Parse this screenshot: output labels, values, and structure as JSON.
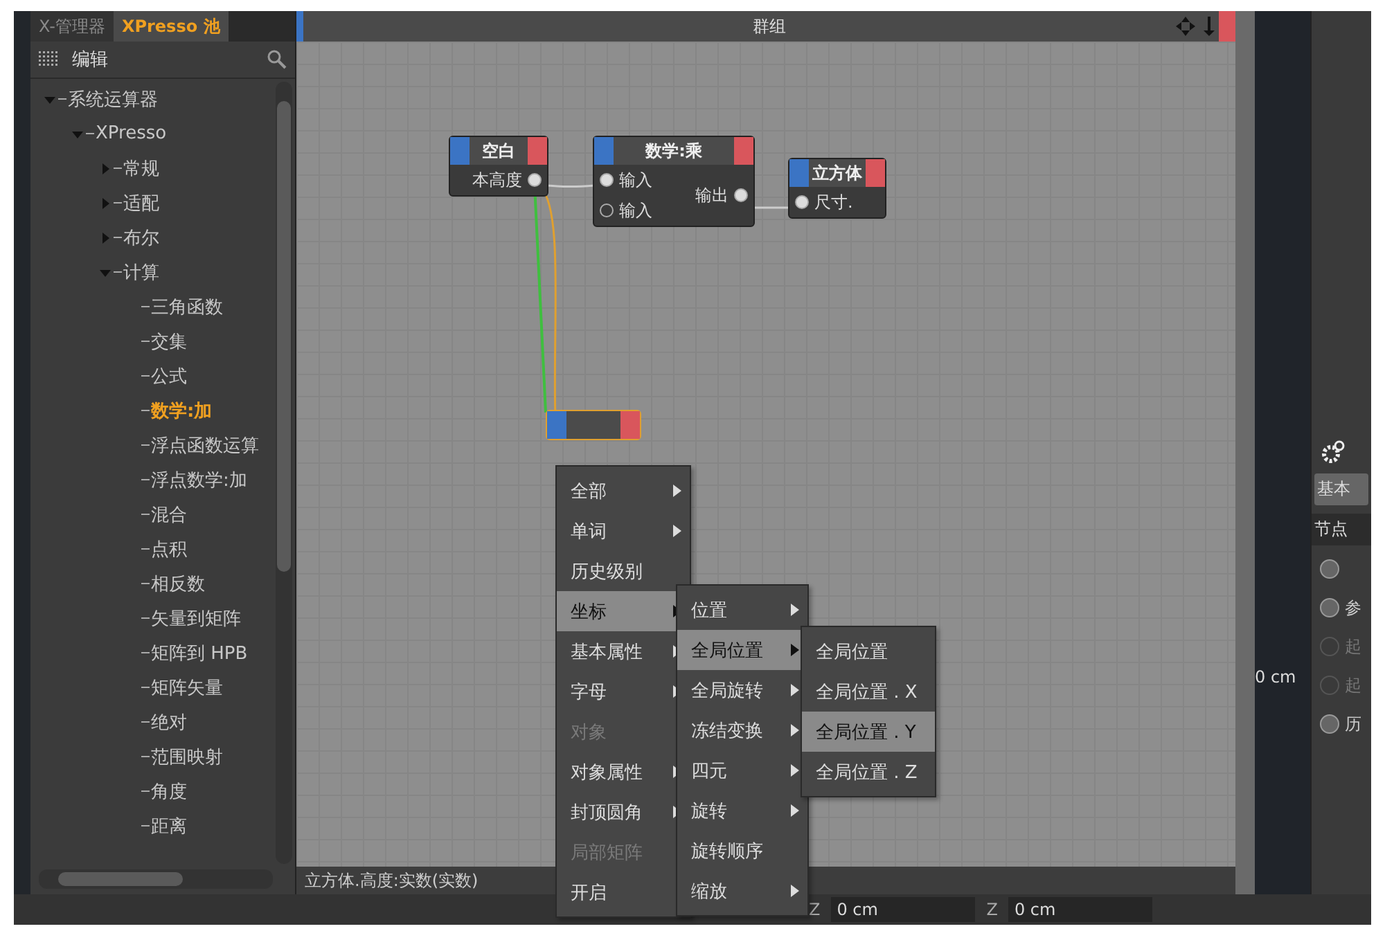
{
  "left_panel": {
    "tabs": [
      {
        "label": "X-管理器",
        "selected": false
      },
      {
        "label": "XPresso 池",
        "selected": true
      }
    ],
    "header": {
      "title": "编辑"
    },
    "tree": [
      {
        "label": "系统运算器",
        "expanded": true,
        "children": [
          {
            "label": "XPresso",
            "expanded": true,
            "children": [
              {
                "label": "常规",
                "expanded": false
              },
              {
                "label": "适配",
                "expanded": false
              },
              {
                "label": "布尔",
                "expanded": false
              },
              {
                "label": "计算",
                "expanded": true,
                "children": [
                  {
                    "label": "三角函数",
                    "selected": false
                  },
                  {
                    "label": "交集",
                    "selected": false
                  },
                  {
                    "label": "公式",
                    "selected": false
                  },
                  {
                    "label": "数学:加",
                    "selected": true
                  },
                  {
                    "label": "浮点函数运算",
                    "selected": false
                  },
                  {
                    "label": "浮点数学:加",
                    "selected": false
                  },
                  {
                    "label": "混合",
                    "selected": false
                  },
                  {
                    "label": "点积",
                    "selected": false
                  },
                  {
                    "label": "相反数",
                    "selected": false
                  },
                  {
                    "label": "矢量到矩阵",
                    "selected": false
                  },
                  {
                    "label": "矩阵到 HPB",
                    "selected": false
                  },
                  {
                    "label": "矩阵矢量",
                    "selected": false
                  },
                  {
                    "label": "绝对",
                    "selected": false
                  },
                  {
                    "label": "范围映射",
                    "selected": false
                  },
                  {
                    "label": "角度",
                    "selected": false
                  },
                  {
                    "label": "距离",
                    "selected": false
                  }
                ]
              }
            ]
          }
        ]
      }
    ]
  },
  "editor": {
    "title": "群组",
    "nodes": [
      {
        "title": "空白",
        "ports": [
          {
            "label": "本高度",
            "kind": "output",
            "connected": true
          }
        ]
      },
      {
        "title": "数学:乘",
        "ports": [
          {
            "label": "输入",
            "kind": "input",
            "connected": true
          },
          {
            "label": "输入",
            "kind": "input",
            "connected": false
          },
          {
            "label": "输出",
            "kind": "output",
            "connected": true
          }
        ]
      },
      {
        "title": "立方体",
        "ports": [
          {
            "label": "尺寸.",
            "kind": "input",
            "connected": true
          }
        ]
      },
      {
        "selected": true
      }
    ],
    "menus": [
      {
        "items": [
          {
            "label": "全部",
            "submenu": true,
            "disabled": false,
            "selected": false
          },
          {
            "label": "单词",
            "submenu": true,
            "disabled": false,
            "selected": false
          },
          {
            "label": "历史级别",
            "submenu": false,
            "disabled": false,
            "selected": false
          },
          {
            "label": "坐标",
            "submenu": true,
            "disabled": false,
            "selected": true
          },
          {
            "label": "基本属性",
            "submenu": true,
            "disabled": false,
            "selected": false
          },
          {
            "label": "字母",
            "submenu": true,
            "disabled": false,
            "selected": false
          },
          {
            "label": "对象",
            "submenu": false,
            "disabled": true,
            "selected": false
          },
          {
            "label": "对象属性",
            "submenu": true,
            "disabled": false,
            "selected": false
          },
          {
            "label": "封顶圆角",
            "submenu": true,
            "disabled": false,
            "selected": false
          },
          {
            "label": "局部矩阵",
            "submenu": false,
            "disabled": true,
            "selected": false
          },
          {
            "label": "开启",
            "submenu": false,
            "disabled": false,
            "selected": false
          }
        ]
      },
      {
        "items": [
          {
            "label": "位置",
            "submenu": true,
            "disabled": false,
            "selected": false
          },
          {
            "label": "全局位置",
            "submenu": true,
            "disabled": false,
            "selected": true
          },
          {
            "label": "全局旋转",
            "submenu": true,
            "disabled": false,
            "selected": false
          },
          {
            "label": "冻结变换",
            "submenu": true,
            "disabled": false,
            "selected": false
          },
          {
            "label": "四元",
            "submenu": true,
            "disabled": false,
            "selected": false
          },
          {
            "label": "旋转",
            "submenu": true,
            "disabled": false,
            "selected": false
          },
          {
            "label": "旋转顺序",
            "submenu": false,
            "disabled": false,
            "selected": false
          },
          {
            "label": "缩放",
            "submenu": true,
            "disabled": false,
            "selected": false
          }
        ]
      },
      {
        "items": [
          {
            "label": "全局位置",
            "submenu": false,
            "disabled": false,
            "selected": false
          },
          {
            "label": "全局位置 . X",
            "submenu": false,
            "disabled": false,
            "selected": false
          },
          {
            "label": "全局位置 . Y",
            "submenu": false,
            "disabled": false,
            "selected": true
          },
          {
            "label": "全局位置 . Z",
            "submenu": false,
            "disabled": false,
            "selected": false
          }
        ]
      }
    ],
    "status": "立方体.高度:实数(实数)"
  },
  "viewport": {
    "reading": "0 cm"
  },
  "right_panel": {
    "tab": "基本",
    "section": "节点",
    "options": [
      {
        "enabled": true
      },
      {
        "label": "参",
        "enabled": true
      },
      {
        "label": "起",
        "enabled": false
      },
      {
        "label": "起",
        "enabled": false
      },
      {
        "label": "历",
        "enabled": true
      }
    ]
  },
  "coordinates": [
    {
      "axis": "Z",
      "value": "0 cm"
    },
    {
      "axis": "Z",
      "value": "0 cm"
    }
  ]
}
